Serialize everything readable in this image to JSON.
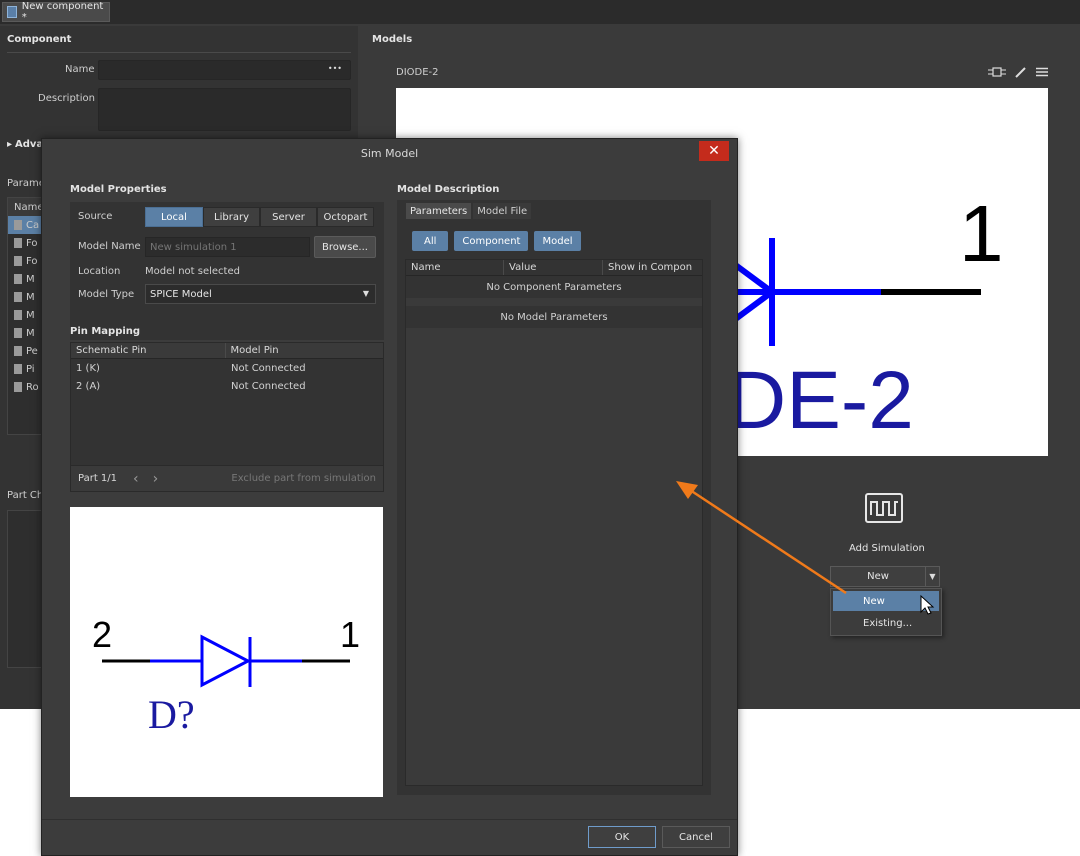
{
  "app": {
    "doc_tab": "New component *",
    "component_section": "Component",
    "name_label": "Name",
    "name_more": "•••",
    "description_label": "Description",
    "advanced_label": "Advan",
    "parameters_label": "Parame",
    "params_list_header": "Name",
    "params_list_items": [
      "Ca",
      "Fo",
      "Fo",
      "M",
      "M",
      "M",
      "M",
      "Pe",
      "Pi",
      "Ro"
    ],
    "part_choices_label": "Part Ch",
    "models_section": "Models",
    "model_name": "DIODE-2",
    "preview_pin_label": "1",
    "preview_text": "DE-2",
    "add_simulation_label": "Add Simulation",
    "add_sim_dropdown_value": "New",
    "add_sim_menu": [
      "New",
      "Existing..."
    ]
  },
  "dialog": {
    "title": "Sim Model",
    "close_glyph": "✕",
    "model_properties": "Model Properties",
    "source_label": "Source",
    "source_options": [
      "Local",
      "Library",
      "Server",
      "Octopart"
    ],
    "source_selected": "Local",
    "model_name_label": "Model Name",
    "model_name_placeholder": "New simulation 1",
    "browse_button": "Browse...",
    "location_label": "Location",
    "location_value": "Model not selected",
    "model_type_label": "Model Type",
    "model_type_value": "SPICE Model",
    "pin_mapping": "Pin Mapping",
    "pin_headers": [
      "Schematic Pin",
      "Model Pin"
    ],
    "pin_rows": [
      {
        "schematic": "1 (K)",
        "model": "Not Connected"
      },
      {
        "schematic": "2 (A)",
        "model": "Not Connected"
      }
    ],
    "part_label": "Part 1/1",
    "prev_glyph": "‹",
    "next_glyph": "›",
    "exclude_label": "Exclude part from simulation",
    "symbol": {
      "pin_left": "2",
      "pin_right": "1",
      "designator": "D?"
    },
    "model_description": "Model Description",
    "desc_tabs": [
      "Parameters",
      "Model File"
    ],
    "filter_buttons": [
      "All",
      "Component",
      "Model"
    ],
    "param_headers": [
      "Name",
      "Value",
      "Show in Compon"
    ],
    "no_component_params": "No Component Parameters",
    "no_model_params": "No Model Parameters",
    "ok_button": "OK",
    "cancel_button": "Cancel"
  },
  "colors": {
    "accent": "#5b80a6",
    "close": "#c42b1c",
    "annotation_arrow": "#f07a1a",
    "diode_blue": "#0000ff",
    "designator_blue": "#1a1aa0"
  }
}
